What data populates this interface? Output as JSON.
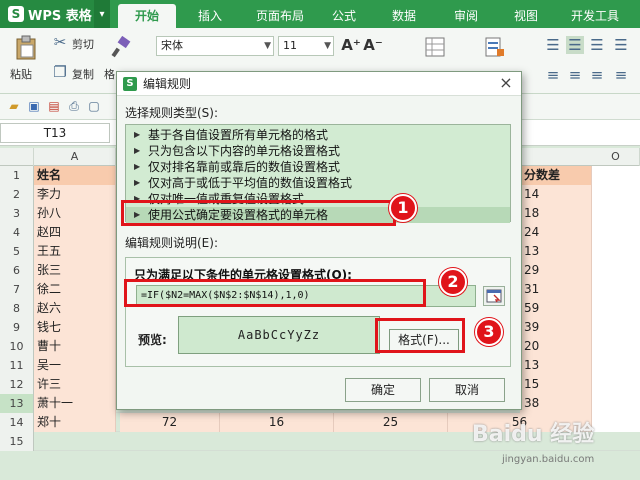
{
  "app": {
    "name": "WPS 表格",
    "logo": "S",
    "menu_arrow": "▾"
  },
  "tabs": [
    {
      "label": "开始"
    },
    {
      "label": "插入"
    },
    {
      "label": "页面布局"
    },
    {
      "label": "公式"
    },
    {
      "label": "数据"
    },
    {
      "label": "审阅"
    },
    {
      "label": "视图"
    },
    {
      "label": "开发工具"
    }
  ],
  "ribbon": {
    "cut": "剪切",
    "paste": "粘贴",
    "copy": "复制",
    "format_painter": "格",
    "font_name": "宋体",
    "font_size": "11",
    "grow_font": "A⁺",
    "shrink_font": "A⁻"
  },
  "formula_bar": {
    "name_box": "T13"
  },
  "grid": {
    "col_headers": {
      "A": "A",
      "O": "O"
    },
    "rows": [
      {
        "n": "1",
        "a": "姓名",
        "r": "分数差",
        "header": true
      },
      {
        "n": "2",
        "a": "李力",
        "r": "14"
      },
      {
        "n": "3",
        "a": "孙八",
        "r": "18"
      },
      {
        "n": "4",
        "a": "赵四",
        "r": "24"
      },
      {
        "n": "5",
        "a": "王五",
        "r": "13"
      },
      {
        "n": "6",
        "a": "张三",
        "r": "29"
      },
      {
        "n": "7",
        "a": "徐二",
        "r": "31"
      },
      {
        "n": "8",
        "a": "赵六",
        "r": "59"
      },
      {
        "n": "9",
        "a": "钱七",
        "r": "39"
      },
      {
        "n": "10",
        "a": "曹十",
        "r": "20"
      },
      {
        "n": "11",
        "a": "吴一",
        "r": "13"
      },
      {
        "n": "12",
        "a": "许三",
        "r": "15"
      },
      {
        "n": "13",
        "a": "萧十一",
        "r": "38"
      },
      {
        "n": "14",
        "a": "郑十",
        "b": "72",
        "c": "16",
        "d": "25",
        "r": "56"
      },
      {
        "n": "15",
        "a": ""
      }
    ]
  },
  "dialog": {
    "title": "编辑规则",
    "close": "×",
    "type_label": "选择规则类型(S):",
    "rule_types": [
      {
        "label": "基于各自值设置所有单元格的格式"
      },
      {
        "label": "只为包含以下内容的单元格设置格式"
      },
      {
        "label": "仅对排名靠前或靠后的数值设置格式"
      },
      {
        "label": "仅对高于或低于平均值的数值设置格式"
      },
      {
        "label": "仅对唯一值或重复值设置格式"
      },
      {
        "label": "使用公式确定要设置格式的单元格"
      }
    ],
    "desc_label": "编辑规则说明(E):",
    "condition_label": "只为满足以下条件的单元格设置格式(O):",
    "formula": "=IF($N2=MAX($N$2:$N$14),1,0)",
    "preview_label": "预览:",
    "preview_text": "AaBbCcYyZz",
    "format_button": "格式(F)...",
    "ok": "确定",
    "cancel": "取消"
  },
  "callouts": [
    "1",
    "2",
    "3"
  ],
  "watermark": {
    "main": "Baidu 经验",
    "url": "jingyan.baidu.com"
  },
  "colors": {
    "accent": "#2f9a4d",
    "callout": "#e0141a",
    "preview_fill": "#cfe9cf",
    "cell_fill": "#fce4d6"
  }
}
